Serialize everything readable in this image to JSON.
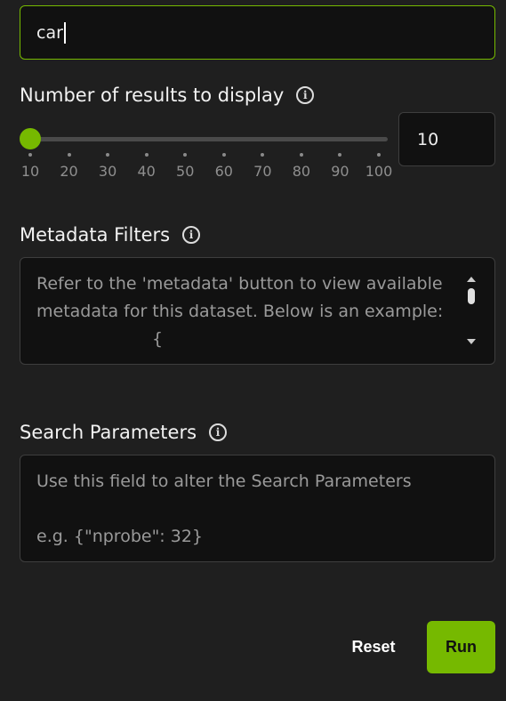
{
  "query": {
    "value": "car"
  },
  "results": {
    "label": "Number of results to display",
    "value": "10",
    "slider_fraction": 0,
    "ticks": [
      "10",
      "20",
      "30",
      "40",
      "50",
      "60",
      "70",
      "80",
      "90",
      "100"
    ]
  },
  "metadata_filters": {
    "label": "Metadata Filters",
    "placeholder_line1": "Refer to the 'metadata' button to view available",
    "placeholder_line2": "metadata for this dataset. Below is an example:",
    "placeholder_line3": "{"
  },
  "search_parameters": {
    "label": "Search Parameters",
    "placeholder_line1": "Use this field to alter the Search Parameters",
    "placeholder_line2": "e.g. {\"nprobe\": 32}"
  },
  "buttons": {
    "reset": "Reset",
    "run": "Run"
  },
  "icons": {
    "info": "info-circle-icon"
  },
  "colors": {
    "accent": "#76b900",
    "background": "#1f1f1f",
    "field": "#111111"
  }
}
